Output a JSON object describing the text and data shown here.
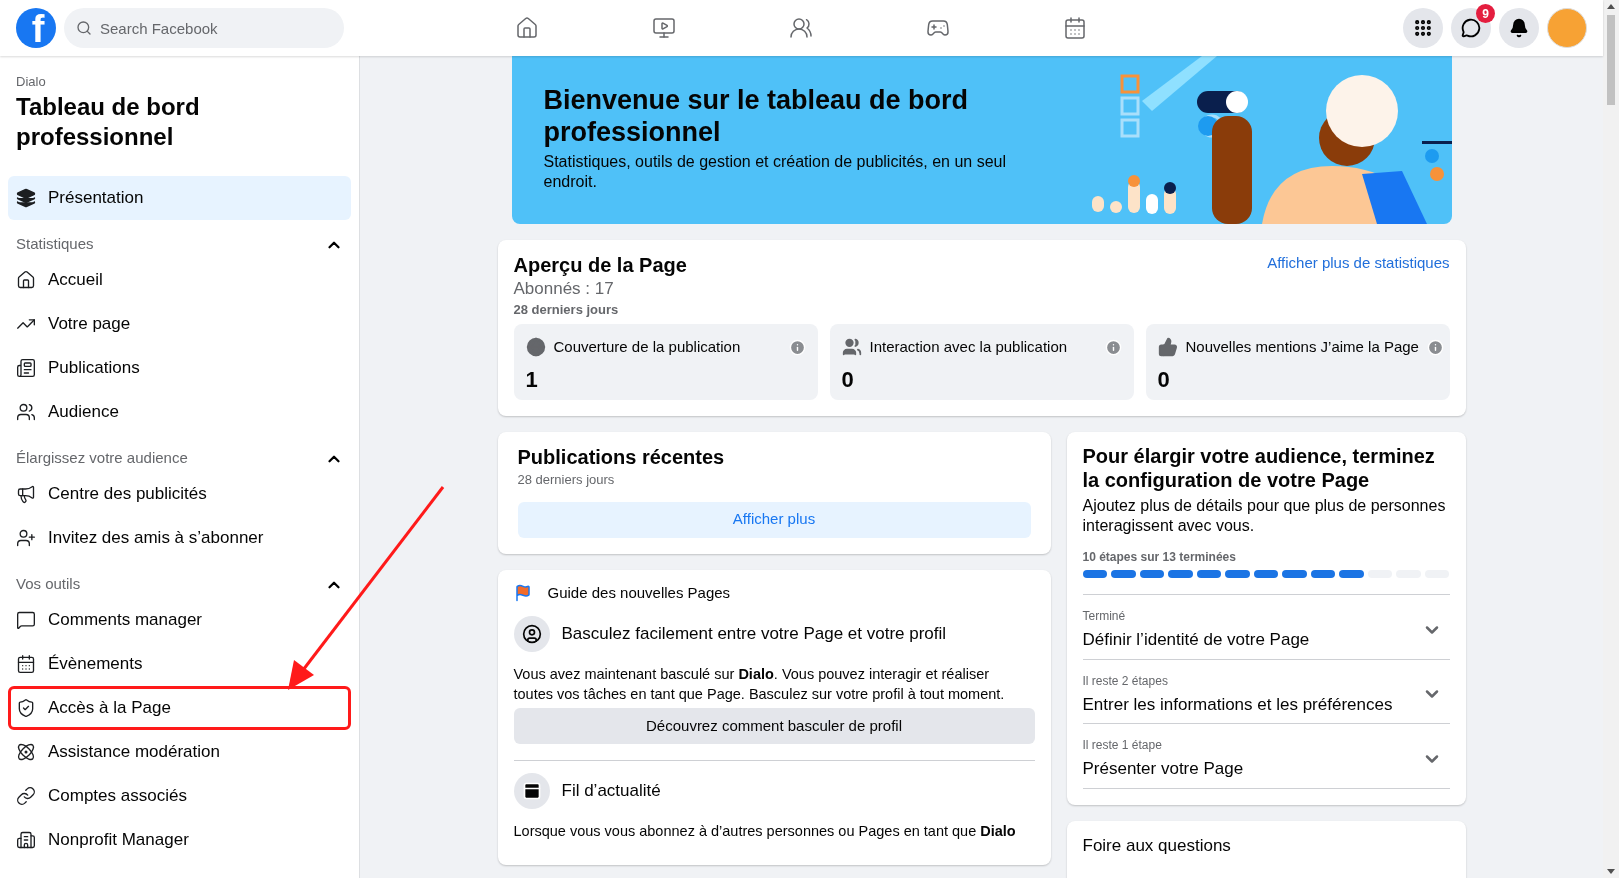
{
  "topbar": {
    "logo": "f",
    "search": {
      "placeholder": "Search Facebook"
    },
    "messenger_badge": "9"
  },
  "sidebar": {
    "page_name": "Dialo",
    "title": "Tableau de bord professionnel",
    "overview": {
      "label": "Présentation",
      "selected": true
    },
    "sections": [
      {
        "title": "Statistiques",
        "expanded": true,
        "items": [
          {
            "label": "Accueil",
            "selected": false,
            "highlighted": false
          },
          {
            "label": "Votre page",
            "selected": false,
            "highlighted": false
          },
          {
            "label": "Publications",
            "selected": false,
            "highlighted": false
          },
          {
            "label": "Audience",
            "selected": false,
            "highlighted": false
          }
        ]
      },
      {
        "title": "Élargissez votre audience",
        "expanded": true,
        "items": [
          {
            "label": "Centre des publicités",
            "selected": false,
            "highlighted": false
          },
          {
            "label": "Invitez des amis à s’abonner",
            "selected": false,
            "highlighted": false
          }
        ]
      },
      {
        "title": "Vos outils",
        "expanded": true,
        "items": [
          {
            "label": "Comments manager",
            "selected": false,
            "highlighted": false
          },
          {
            "label": "Évènements",
            "selected": false,
            "highlighted": false
          },
          {
            "label": "Accès à la Page",
            "selected": false,
            "highlighted": true
          },
          {
            "label": "Assistance modération",
            "selected": false,
            "highlighted": false
          },
          {
            "label": "Comptes associés",
            "selected": false,
            "highlighted": false
          },
          {
            "label": "Nonprofit Manager",
            "selected": false,
            "highlighted": false
          }
        ]
      }
    ]
  },
  "banner": {
    "title": "Bienvenue sur le tableau de bord professionnel",
    "subtitle": "Statistiques, outils de gestion et création de publicités, en un seul endroit."
  },
  "overview": {
    "title": "Aperçu de la Page",
    "followers": "Abonnés : 17",
    "period": "28 derniers jours",
    "link": "Afficher plus de statistiques",
    "metrics": [
      {
        "label": "Couverture de la publication",
        "value": "1"
      },
      {
        "label": "Interaction avec la publication",
        "value": "0"
      },
      {
        "label": "Nouvelles mentions J’aime la Page",
        "value": "0"
      }
    ]
  },
  "recent": {
    "title": "Publications récentes",
    "period": "28 derniers jours",
    "button": "Afficher plus"
  },
  "guide": {
    "title": "Guide des nouvelles Pages",
    "items": [
      {
        "title": "Basculez facilement entre votre Page et votre profil",
        "body": "Vous avez maintenant basculé sur **Dialo**. Vous pouvez interagir et réaliser toutes vos tâches en tant que Page. Basculez sur votre profil à tout moment.",
        "button": "Découvrez comment basculer de profil"
      },
      {
        "title": "Fil d’actualité",
        "body": "Lorsque vous vous abonnez à d’autres personnes ou Pages en tant que **Dialo**"
      }
    ]
  },
  "setup": {
    "title": "Pour élargir votre audience, terminez la configuration de votre Page",
    "subtitle": "Ajoutez plus de détails pour que plus de personnes interagissent avec vous.",
    "progress_label": "10 étapes sur 13 terminées",
    "segments": [
      {
        "done": true
      },
      {
        "done": true
      },
      {
        "done": true
      },
      {
        "done": true
      },
      {
        "done": true
      },
      {
        "done": true
      },
      {
        "done": true
      },
      {
        "done": true
      },
      {
        "done": true
      },
      {
        "done": true
      },
      {
        "done": false
      },
      {
        "done": false
      },
      {
        "done": false
      }
    ],
    "steps": [
      {
        "status": "Terminé",
        "title": "Définir l’identité de votre Page",
        "expanded": false
      },
      {
        "status": "Il reste 2 étapes",
        "title": "Entrer les informations et les préférences",
        "expanded": false
      },
      {
        "status": "Il reste 1 étape",
        "title": "Présenter votre Page",
        "expanded": false
      }
    ]
  },
  "faq": {
    "title": "Foire aux questions"
  }
}
